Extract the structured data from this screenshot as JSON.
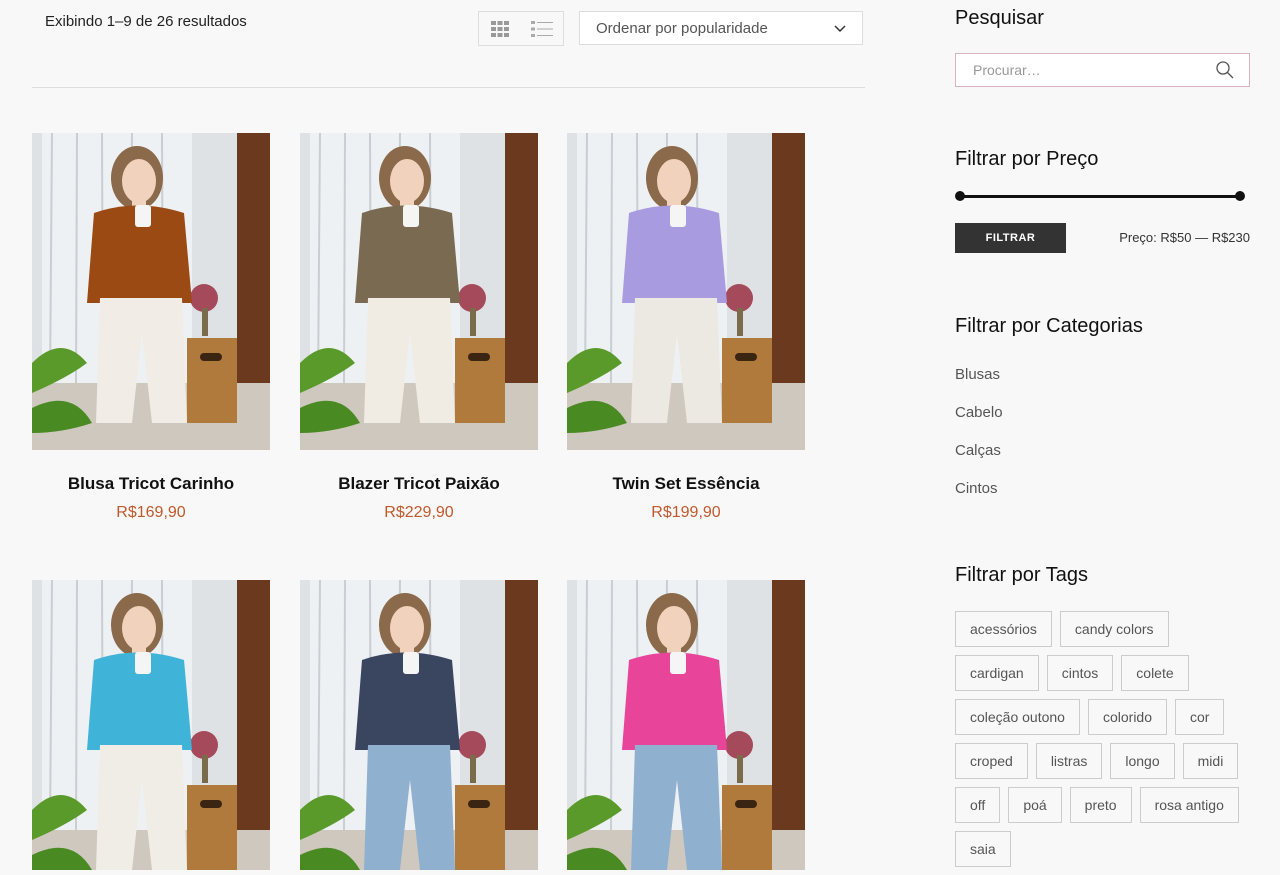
{
  "toolbar": {
    "result_count": "Exibindo 1–9 de 26 resultados",
    "sort_label": "Ordenar por popularidade"
  },
  "products": [
    {
      "title": "Blusa Tricot Carinho",
      "price": "R$169,90",
      "top_color": "#9a4a12",
      "bottom_color": "#f1ece6"
    },
    {
      "title": "Blazer Tricot Paixão",
      "price": "R$229,90",
      "top_color": "#7a6a52",
      "bottom_color": "#f0ece4"
    },
    {
      "title": "Twin Set Essência",
      "price": "R$199,90",
      "top_color": "#a99be0",
      "bottom_color": "#ece9e2"
    },
    {
      "title": "",
      "price": "",
      "top_color": "#3fb3d8",
      "bottom_color": "#f0ede6"
    },
    {
      "title": "",
      "price": "",
      "top_color": "#3a4560",
      "bottom_color": "#8fb0cf"
    },
    {
      "title": "",
      "price": "",
      "top_color": "#e8459a",
      "bottom_color": "#8fb0cf"
    }
  ],
  "sidebar": {
    "search_heading": "Pesquisar",
    "search_placeholder": "Procurar…",
    "price_heading": "Filtrar por Preço",
    "filter_button": "FILTRAR",
    "price_label": "Preço: R$50 — R$230",
    "price_range": [
      50,
      230
    ],
    "categories_heading": "Filtrar por Categorias",
    "categories": [
      "Blusas",
      "Cabelo",
      "Calças",
      "Cintos"
    ],
    "tags_heading": "Filtrar por Tags",
    "tags": [
      "acessórios",
      "candy colors",
      "cardigan",
      "cintos",
      "colete",
      "coleção outono",
      "colorido",
      "cor",
      "croped",
      "listras",
      "longo",
      "midi",
      "off",
      "poá",
      "preto",
      "rosa antigo",
      "saia"
    ]
  },
  "colors": {
    "price": "#c0582c",
    "button": "#333333",
    "accent_border": "#d9b3bd"
  }
}
